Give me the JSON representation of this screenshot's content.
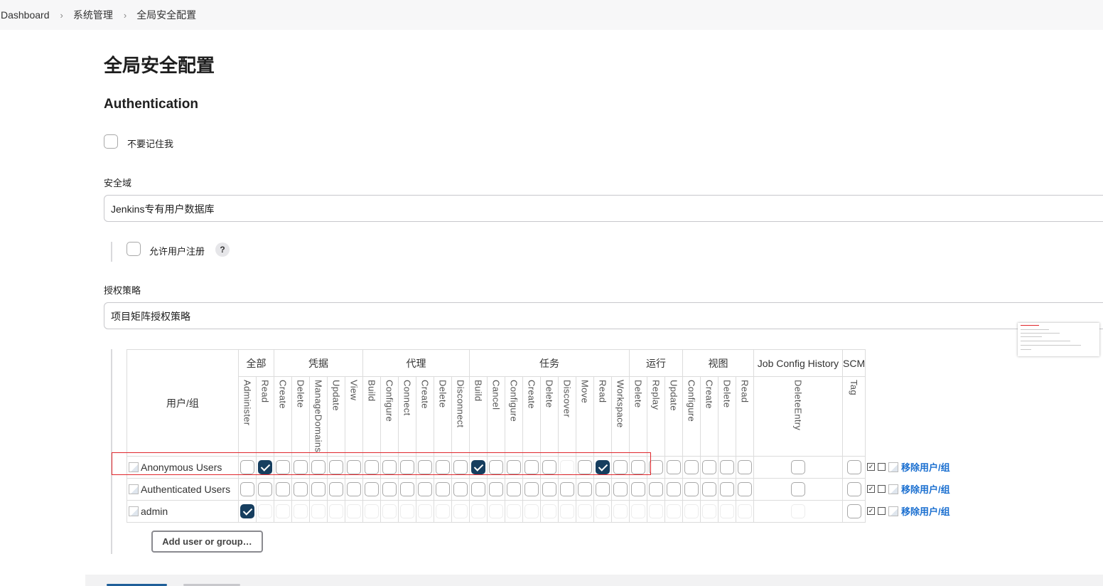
{
  "breadcrumb": {
    "items": [
      "Dashboard",
      "系统管理",
      "全局安全配置"
    ]
  },
  "page": {
    "title": "全局安全配置"
  },
  "authentication": {
    "title": "Authentication",
    "remember_me_label": "不要记住我",
    "remember_me_checked": false
  },
  "security_realm": {
    "label": "安全域",
    "value": "Jenkins专有用户数据库",
    "allow_signup_label": "允许用户注册",
    "allow_signup_checked": false,
    "help": "?"
  },
  "authorization": {
    "label": "授权策略",
    "value": "项目矩阵授权策略"
  },
  "matrix": {
    "user_header": "用户/组",
    "groups": [
      {
        "label": "全部",
        "span": 2
      },
      {
        "label": "凭据",
        "span": 5
      },
      {
        "label": "代理",
        "span": 6
      },
      {
        "label": "任务",
        "span": 9
      },
      {
        "label": "运行",
        "span": 3
      },
      {
        "label": "视图",
        "span": 4
      },
      {
        "label": "Job Config History",
        "span": 1
      },
      {
        "label": "SCM",
        "span": 1
      }
    ],
    "permissions": [
      "Administer",
      "Read",
      "Create",
      "Delete",
      "ManageDomains",
      "Update",
      "View",
      "Build",
      "Configure",
      "Connect",
      "Create",
      "Delete",
      "Disconnect",
      "Build",
      "Cancel",
      "Configure",
      "Create",
      "Delete",
      "Discover",
      "Move",
      "Read",
      "Workspace",
      "Delete",
      "Replay",
      "Update",
      "Configure",
      "Create",
      "Delete",
      "Read",
      "DeleteEntry",
      "Tag"
    ],
    "rows": [
      {
        "name": "Anonymous Users",
        "checked": [
          1,
          13,
          20
        ],
        "faint": [
          18
        ]
      },
      {
        "name": "Authenticated Users",
        "checked": [],
        "faint": []
      },
      {
        "name": "admin",
        "checked": [
          0
        ],
        "faint": "all-except-0"
      }
    ],
    "row_action_label": "移除用户/组",
    "add_button_label": "Add user or group…"
  }
}
